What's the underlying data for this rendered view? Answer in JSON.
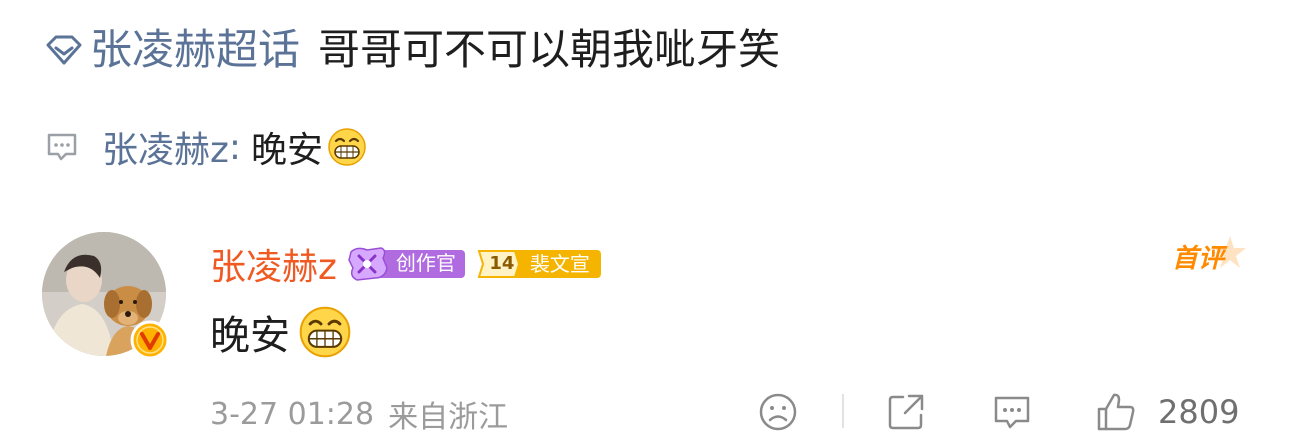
{
  "topic": {
    "name": "张凌赫超话",
    "title": "哥哥可不可以朝我呲牙笑",
    "icon": "diamond-icon"
  },
  "reply": {
    "author": "张凌赫z",
    "separator": ":",
    "text": "晚安",
    "icon": "comment-bubble-icon",
    "emoji": "grin-emoji"
  },
  "comment": {
    "username": "张凌赫z",
    "badges": {
      "creator": "创作官",
      "fan_level": "14",
      "fan_label": "裴文宣"
    },
    "first_comment_label": "首评",
    "text": "晚安",
    "emoji": "grin-emoji",
    "date": "3-27 01:28",
    "location": "来自浙江",
    "like_count": "2809"
  },
  "colors": {
    "link_blue": "#5b7397",
    "username_orange": "#f05a22",
    "first_comment_orange": "#ff8a00",
    "meta_gray": "#9b9b9b"
  }
}
